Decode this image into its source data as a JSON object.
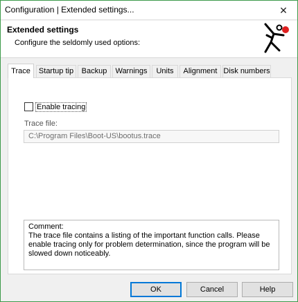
{
  "window": {
    "title": "Configuration | Extended settings...",
    "close_glyph": "✕"
  },
  "header": {
    "title": "Extended settings",
    "subtitle": "Configure the seldomly used options:",
    "logo_icon": "boot-us-figure-logo",
    "logo_accent_color": "#e02020"
  },
  "tabs": [
    {
      "label": "Trace",
      "active": true
    },
    {
      "label": "Startup tip",
      "active": false
    },
    {
      "label": "Backup",
      "active": false
    },
    {
      "label": "Warnings",
      "active": false
    },
    {
      "label": "Units",
      "active": false
    },
    {
      "label": "Alignment",
      "active": false
    },
    {
      "label": "Disk numbers",
      "active": false
    }
  ],
  "trace": {
    "enable_label": "Enable tracing",
    "enable_checked": false,
    "file_label": "Trace file:",
    "file_value": "C:\\Program Files\\Boot-US\\bootus.trace"
  },
  "comment": {
    "title": "Comment:",
    "body": "The trace file contains a listing of the important function calls. Please enable tracing only for problem determination, since the program will be slowed down noticeably."
  },
  "buttons": {
    "ok": "OK",
    "cancel": "Cancel",
    "help": "Help"
  },
  "colors": {
    "window_border": "#3c9a4a",
    "default_button_border": "#0078d7"
  }
}
